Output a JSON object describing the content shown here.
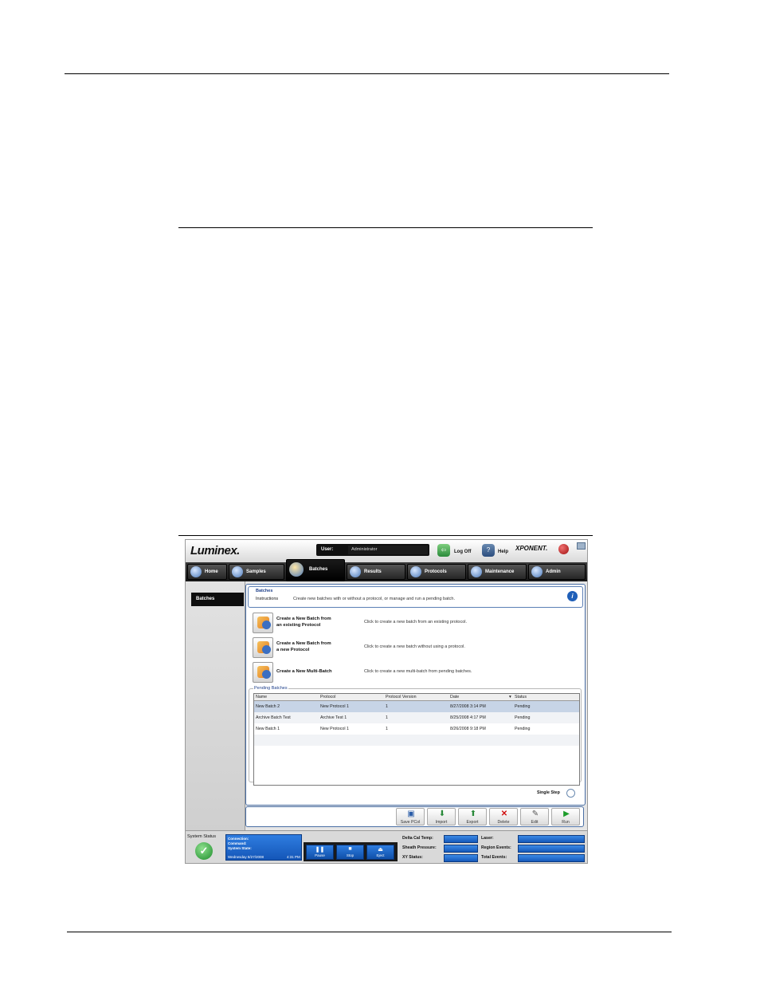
{
  "topbar": {
    "brand": "Luminex.",
    "user_label": "User:",
    "user_value": "Administrator",
    "logoff_label": "Log Off",
    "help_label": "Help",
    "product": "XPONENT."
  },
  "tabs": [
    {
      "label": "Home"
    },
    {
      "label": "Samples"
    },
    {
      "label": "Batches"
    },
    {
      "label": "Results"
    },
    {
      "label": "Protocols"
    },
    {
      "label": "Maintenance"
    },
    {
      "label": "Admin"
    }
  ],
  "sidebar": {
    "items": [
      {
        "label": "Batches"
      }
    ]
  },
  "instructions": {
    "heading": "Batches",
    "label": "Instructions",
    "text": "Create new batches with or without a protocol, or manage and run a pending batch."
  },
  "actions": [
    {
      "title1": "Create a New Batch from",
      "title2": "an existing Protocol",
      "desc": "Click to create a new batch from an existing protocol."
    },
    {
      "title1": "Create a New Batch from",
      "title2": "a new Protocol",
      "desc": "Click to create a new batch without using a protocol."
    },
    {
      "title1": "Create a New Multi-Batch",
      "title2": "",
      "desc": "Click to create a new multi-batch from pending batches."
    }
  ],
  "pending": {
    "title": "Pending Batches",
    "columns": [
      "Name",
      "Protocol",
      "Protocol Version",
      "Date",
      "Status"
    ],
    "rows": [
      {
        "name": "New Batch 2",
        "protocol": "New Protocol 1",
        "version": "1",
        "date": "8/27/2008 3:14 PM",
        "status": "Pending"
      },
      {
        "name": "Archive Batch Test",
        "protocol": "Archive Test 1",
        "version": "1",
        "date": "8/25/2008 4:17 PM",
        "status": "Pending"
      },
      {
        "name": "New Batch 1",
        "protocol": "New Protocol 1",
        "version": "1",
        "date": "8/26/2008 9:18 PM",
        "status": "Pending"
      }
    ],
    "single_step_label": "Single Step"
  },
  "toolbar": {
    "save_pcol": "Save PCol",
    "import": "Import",
    "export": "Export",
    "delete": "Delete",
    "edit": "Edit",
    "run": "Run"
  },
  "status": {
    "label": "System Status",
    "connection": "Connection:",
    "command": "Command:",
    "system_state": "System State:",
    "date": "Wednesday 8/27/2008",
    "time": "4:31 PM",
    "pause": "Pause",
    "stop": "Stop",
    "eject": "Eject",
    "delta_cal_temp": "Delta Cal Temp:",
    "sheath_pressure": "Sheath Pressure:",
    "xy_status": "XY Status:",
    "laser": "Laser:",
    "region_events": "Region Events:",
    "total_events": "Total Events:"
  },
  "colors": {
    "accent_blue": "#1456b8",
    "selected_row": "#c7d4e6",
    "delete_red": "#d01010",
    "run_green": "#1c9c2a"
  }
}
